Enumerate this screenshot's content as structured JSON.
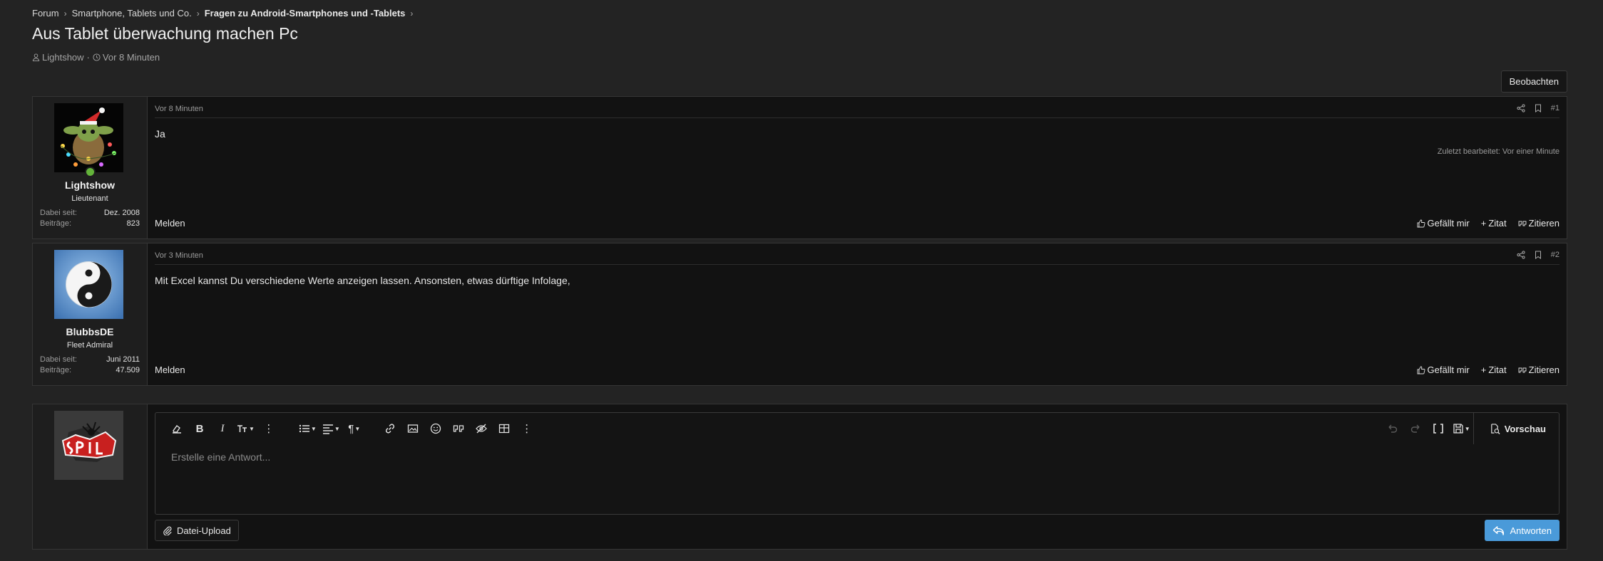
{
  "breadcrumb": {
    "items": [
      "Forum",
      "Smartphone, Tablets und Co.",
      "Fragen zu Android-Smartphones und -Tablets"
    ]
  },
  "thread": {
    "title": "Aus Tablet überwachung machen Pc",
    "author": "Lightshow",
    "separator": "·",
    "age": "Vor 8 Minuten"
  },
  "watch_label": "Beobachten",
  "posts": [
    {
      "username": "Lightshow",
      "usertitle": "Lieutenant",
      "joined_label": "Dabei seit:",
      "joined": "Dez. 2008",
      "posts_label": "Beiträge:",
      "posts": "823",
      "date": "Vor 8 Minuten",
      "number": "#1",
      "body": "Ja",
      "last_edit": "Zuletzt bearbeitet: Vor einer Minute",
      "report": "Melden",
      "like": "Gefällt mir",
      "quote": "Zitat",
      "reply_quote": "Zitieren"
    },
    {
      "username": "BlubbsDE",
      "usertitle": "Fleet Admiral",
      "joined_label": "Dabei seit:",
      "joined": "Juni 2011",
      "posts_label": "Beiträge:",
      "posts": "47.509",
      "date": "Vor 3 Minuten",
      "number": "#2",
      "body": "Mit Excel kannst Du verschiedene Werte anzeigen lassen. Ansonsten, etwas dürftige Infolage,",
      "report": "Melden",
      "like": "Gefällt mir",
      "quote": "Zitat",
      "reply_quote": "Zitieren"
    }
  ],
  "editor": {
    "placeholder": "Erstelle eine Antwort...",
    "preview": "Vorschau",
    "upload": "Datei-Upload",
    "submit": "Antworten"
  },
  "colors": {
    "background": "#232323",
    "panel": "#121212",
    "accent": "#4a9ad9",
    "online": "#63b33a"
  }
}
